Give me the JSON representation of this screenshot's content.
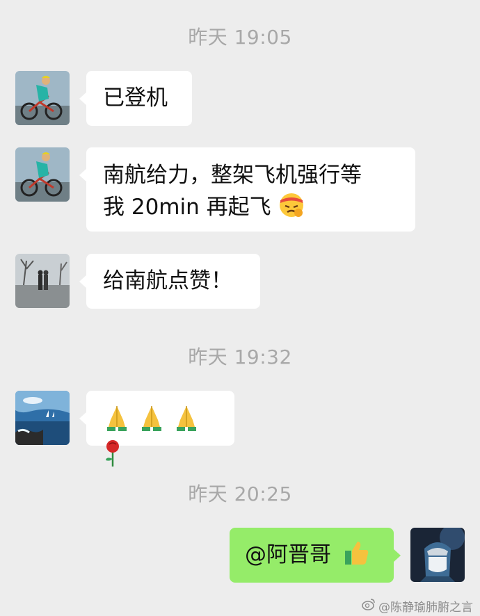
{
  "timestamps": [
    "昨天 19:05",
    "昨天 19:32",
    "昨天 20:25"
  ],
  "messages": [
    {
      "text": "已登机"
    },
    {
      "line1": "南航给力，整架飞机强行等",
      "line2": "我 20min 再起飞",
      "emoji": "angry-headband-emoji"
    },
    {
      "text": "给南航点赞！"
    },
    {
      "emojis": [
        "pray-emoji",
        "pray-emoji",
        "pray-emoji",
        "rose-emoji"
      ]
    },
    {
      "text": "@阿晋哥",
      "emoji": "thumbs-up-emoji"
    }
  ],
  "watermark": "@陈静瑜肺腑之言",
  "colors": {
    "background": "#ededed",
    "incoming_bubble": "#ffffff",
    "outgoing_bubble": "#95ec69",
    "timestamp": "#a8a8a8"
  }
}
